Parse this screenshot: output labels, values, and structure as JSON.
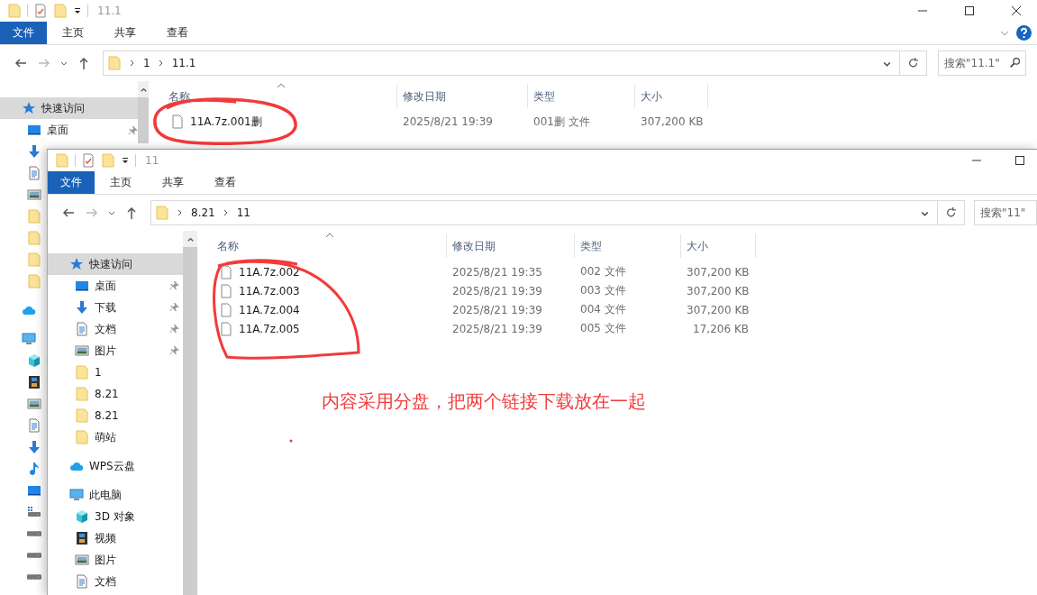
{
  "back_window": {
    "title": "11.1",
    "ribbon_tabs": [
      {
        "label": "文件",
        "kind": "menu"
      },
      {
        "label": "主页",
        "kind": "tab"
      },
      {
        "label": "共享",
        "kind": "tab"
      },
      {
        "label": "查看",
        "kind": "tab"
      }
    ],
    "address": [
      "1",
      "11.1"
    ],
    "search": {
      "placeholder": "搜索\"11.1\""
    },
    "sidebar": [
      {
        "label": "快速访问",
        "kind": "star",
        "selected": true,
        "pinned": false,
        "children": [
          {
            "label": "桌面",
            "kind": "desktop",
            "selected": false,
            "pinned": true
          },
          {
            "kind": "download",
            "selected": false
          },
          {
            "kind": "document",
            "selected": false
          },
          {
            "kind": "picture",
            "selected": false
          },
          {
            "kind": "folder",
            "selected": false
          },
          {
            "kind": "folder",
            "selected": false
          },
          {
            "kind": "folder",
            "selected": false
          },
          {
            "kind": "folder",
            "selected": false
          }
        ]
      },
      {
        "kind": "cloud",
        "selected": false
      },
      {
        "kind": "computer",
        "selected": false,
        "children": [
          {
            "kind": "cube",
            "selected": false
          },
          {
            "kind": "video",
            "selected": false
          },
          {
            "kind": "picture",
            "selected": false
          },
          {
            "kind": "document",
            "selected": false
          },
          {
            "kind": "download",
            "selected": false
          },
          {
            "kind": "music",
            "selected": false
          },
          {
            "kind": "desktop",
            "selected": false
          },
          {
            "kind": "drive_win",
            "selected": false
          },
          {
            "kind": "drive",
            "selected": false
          },
          {
            "kind": "drive",
            "selected": false
          },
          {
            "kind": "drive",
            "selected": false
          }
        ]
      }
    ],
    "columns": [
      "名称",
      "修改日期",
      "类型",
      "大小"
    ],
    "rows": [
      {
        "name": "11A.7z.001删",
        "modified": "2025/8/21 19:39",
        "type": "001删 文件",
        "size": "307,200 KB"
      }
    ]
  },
  "front_window": {
    "title": "11",
    "ribbon_tabs": [
      {
        "label": "文件",
        "kind": "menu"
      },
      {
        "label": "主页",
        "kind": "tab"
      },
      {
        "label": "共享",
        "kind": "tab"
      },
      {
        "label": "查看",
        "kind": "tab"
      }
    ],
    "address": [
      "8.21",
      "11"
    ],
    "search": {
      "placeholder": "搜索\"11\""
    },
    "sidebar": [
      {
        "label": "快速访问",
        "kind": "star",
        "selected": true,
        "pinned": false,
        "children": [
          {
            "label": "桌面",
            "kind": "desktop",
            "selected": false,
            "pinned": true
          },
          {
            "label": "下载",
            "kind": "download",
            "selected": false,
            "pinned": true
          },
          {
            "label": "文档",
            "kind": "document",
            "selected": false,
            "pinned": true
          },
          {
            "label": "图片",
            "kind": "picture",
            "selected": false,
            "pinned": true
          },
          {
            "label": "1",
            "kind": "folder",
            "selected": false,
            "pinned": false
          },
          {
            "label": "8.21",
            "kind": "folder",
            "selected": false,
            "pinned": false
          },
          {
            "label": "8.21",
            "kind": "folder",
            "selected": false,
            "pinned": false
          },
          {
            "label": "萌站",
            "kind": "folder",
            "selected": false,
            "pinned": false
          }
        ]
      },
      {
        "label": "WPS云盘",
        "kind": "cloud",
        "selected": false,
        "pinned": false
      },
      {
        "label": "此电脑",
        "kind": "computer",
        "selected": false,
        "pinned": false,
        "children": [
          {
            "label": "3D 对象",
            "kind": "cube",
            "selected": false,
            "pinned": false
          },
          {
            "label": "视频",
            "kind": "video",
            "selected": false,
            "pinned": false
          },
          {
            "label": "图片",
            "kind": "picture",
            "selected": false,
            "pinned": false
          },
          {
            "label": "文档",
            "kind": "document",
            "selected": false,
            "pinned": false
          }
        ]
      }
    ],
    "columns": [
      "名称",
      "修改日期",
      "类型",
      "大小"
    ],
    "rows": [
      {
        "name": "11A.7z.002",
        "modified": "2025/8/21 19:35",
        "type": "002 文件",
        "size": "307,200 KB"
      },
      {
        "name": "11A.7z.003",
        "modified": "2025/8/21 19:39",
        "type": "003 文件",
        "size": "307,200 KB"
      },
      {
        "name": "11A.7z.004",
        "modified": "2025/8/21 19:39",
        "type": "004 文件",
        "size": "307,200 KB"
      },
      {
        "name": "11A.7z.005",
        "modified": "2025/8/21 19:39",
        "type": "005 文件",
        "size": "17,206 KB"
      }
    ]
  },
  "annotation": {
    "text": "内容采用分盘，把两个链接下载放在一起"
  }
}
